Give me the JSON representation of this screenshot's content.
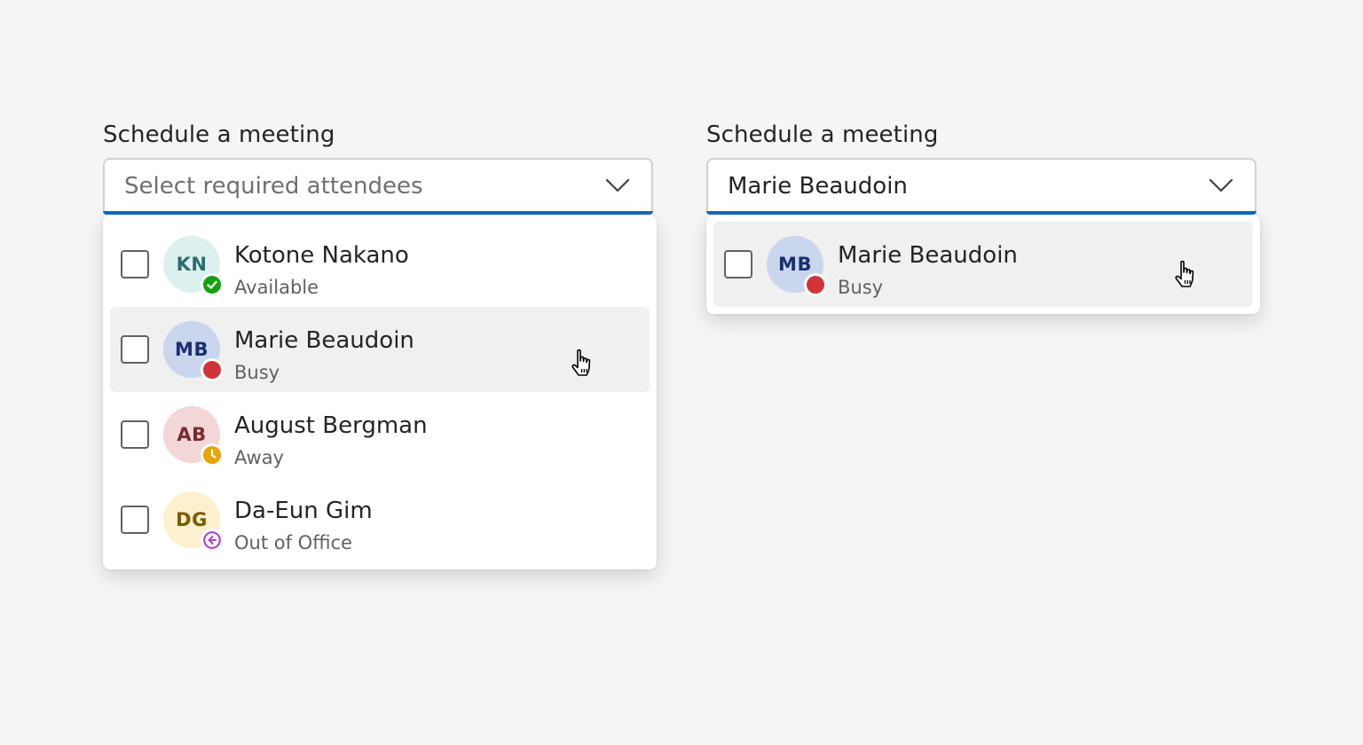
{
  "left": {
    "label": "Schedule a meeting",
    "placeholder": "Select required attendees",
    "options": [
      {
        "initials": "KN",
        "name": "Kotone Nakano",
        "status": "Available",
        "avatar_bg": "#dcf0f0",
        "avatar_fg": "#2e6b6b",
        "presence": "available",
        "presence_color": "#13a10e",
        "hovered": false
      },
      {
        "initials": "MB",
        "name": "Marie Beaudoin",
        "status": "Busy",
        "avatar_bg": "#c9d6ee",
        "avatar_fg": "#1b2f6e",
        "presence": "busy",
        "presence_color": "#d13438",
        "hovered": true
      },
      {
        "initials": "AB",
        "name": "August Bergman",
        "status": "Away",
        "avatar_bg": "#f3d6d8",
        "avatar_fg": "#7a2a33",
        "presence": "away",
        "presence_color": "#eaa300",
        "hovered": false
      },
      {
        "initials": "DG",
        "name": "Da-Eun Gim",
        "status": "Out of Office",
        "avatar_bg": "#fdf0cf",
        "avatar_fg": "#7a5a00",
        "presence": "out-of-office",
        "presence_color": "#b146c2",
        "hovered": false
      }
    ]
  },
  "right": {
    "label": "Schedule a meeting",
    "value": "Marie Beaudoin",
    "options": [
      {
        "initials": "MB",
        "name": "Marie Beaudoin",
        "status": "Busy",
        "avatar_bg": "#c9d6ee",
        "avatar_fg": "#1b2f6e",
        "presence": "busy",
        "presence_color": "#d13438",
        "hovered": true
      }
    ]
  },
  "icons": {
    "chevron": "chevron-down-icon",
    "cursor": "hand-pointer-cursor-icon"
  },
  "colors": {
    "accent": "#0f6cbd",
    "background": "#f5f5f5"
  }
}
